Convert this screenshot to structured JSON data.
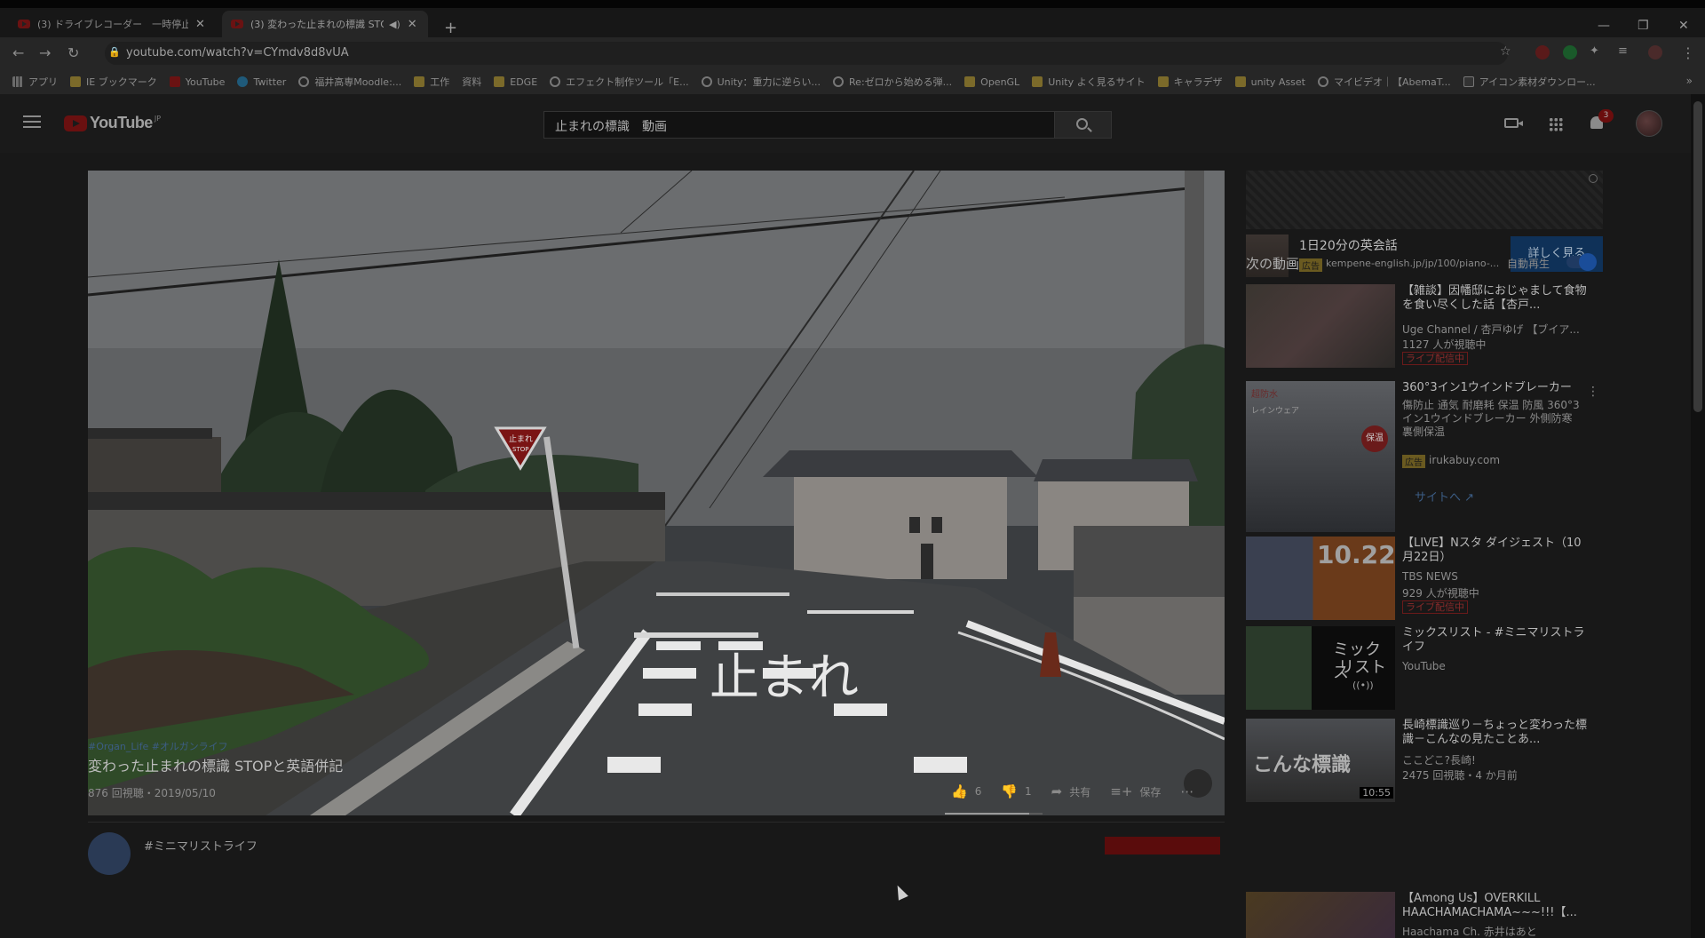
{
  "browser": {
    "tabs": [
      {
        "title": "(3) ドライブレコーダー　一時停止標識",
        "active": false
      },
      {
        "title": "(3) 変わった止まれの標識 STOP",
        "active": true
      }
    ],
    "url": "youtube.com/watch?v=CYmdv8d8vUA",
    "bookmarks": [
      {
        "label": "アプリ",
        "icon": "apps-icon"
      },
      {
        "label": "IE ブックマーク",
        "icon": "folder-icon"
      },
      {
        "label": "YouTube",
        "icon": "youtube-icon"
      },
      {
        "label": "Twitter",
        "icon": "twitter-icon"
      },
      {
        "label": "福井高専Moodle:...",
        "icon": "globe-icon"
      },
      {
        "label": "工作",
        "icon": "folder-icon"
      },
      {
        "label": "資料",
        "icon": "none"
      },
      {
        "label": "EDGE",
        "icon": "folder-icon"
      },
      {
        "label": "エフェクト制作ツール「E...",
        "icon": "globe-icon"
      },
      {
        "label": "Unity：重力に逆らい...",
        "icon": "globe-icon"
      },
      {
        "label": "Re:ゼロから始める弾...",
        "icon": "globe-icon"
      },
      {
        "label": "OpenGL",
        "icon": "folder-icon"
      },
      {
        "label": "Unity よく見るサイト",
        "icon": "folder-icon"
      },
      {
        "label": "キャラデザ",
        "icon": "folder-icon"
      },
      {
        "label": "unity Asset",
        "icon": "folder-icon"
      },
      {
        "label": "マイビデオ｜【AbemaT...",
        "icon": "globe-icon"
      },
      {
        "label": "アイコン素材ダウンロー...",
        "icon": "abema-icon"
      }
    ]
  },
  "youtube": {
    "logo_text": "YouTube",
    "logo_region": "JP",
    "search_query": "止まれの標識　動画",
    "notification_count": "3",
    "video": {
      "hashtags": "#Organ_Life #オルガンライフ",
      "title": "変わった止まれの標識 STOPと英語併記",
      "meta": "876 回視聴・2019/05/10",
      "likes": "6",
      "dislikes": "1",
      "like_ratio": 0.86,
      "share_label": "共有",
      "save_label": "保存",
      "sign_text_1": "止まれ",
      "sign_text_2": "STOP",
      "road_text": "止まれ",
      "channel_name": "#ミニマリストライフ"
    },
    "ad": {
      "title": "1日20分の英会話",
      "tag": "広告",
      "url": "kempene-english.jp/jp/100/piano-...",
      "cta": "詳しく見る"
    },
    "next_label": "次の動画",
    "autoplay_label": "自動再生",
    "recommendations": [
      {
        "title": "【雑談】因幡邸におじゃまして食物を食い尽くした話【杏戸...",
        "channel": "Uge Channel / 杏戸ゆげ 【ブイア...",
        "stat": "1127 人が視聴中",
        "badge": "ライブ配信中"
      },
      {
        "title": "360°3イン1ウインドブレーカー",
        "desc": "傷防止 通気 耐磨耗 保温 防風 360°3イン1ウインドブレーカー 外側防寒 裏側保温",
        "tag": "広告",
        "channel": "irukabuy.com",
        "link": "サイトへ",
        "thumb_text_1": "超防水",
        "thumb_text_2": "レインウェア",
        "thumb_text_3": "保温"
      },
      {
        "title": "【LIVE】Nスタ ダイジェスト（10月22日）",
        "channel": "TBS NEWS",
        "stat": "929 人が視聴中",
        "badge": "ライブ配信中",
        "thumb_text": "10.22"
      },
      {
        "title": "ミックスリスト - #ミニマリストライフ",
        "channel": "YouTube",
        "thumb_text_1": "ミックス",
        "thumb_text_2": "リスト"
      },
      {
        "title": "長崎標識巡り－ちょっと変わった標識－こんなの見たことあ...",
        "channel": "ここどこ?長崎!",
        "stat": "2475 回視聴・4 か月前",
        "duration": "10:55",
        "thumb_text": "こんな標識"
      },
      {
        "title": "【Among Us】OVERKILL HAACHAMACHAMA~~~!!!【...",
        "channel": "Haachama Ch. 赤井はあと"
      }
    ]
  },
  "colors": {
    "overlay_dim": "#000000",
    "youtube_red": "#6a1010",
    "cta_blue": "#0f3158",
    "link_blue": "#3c5d85"
  }
}
